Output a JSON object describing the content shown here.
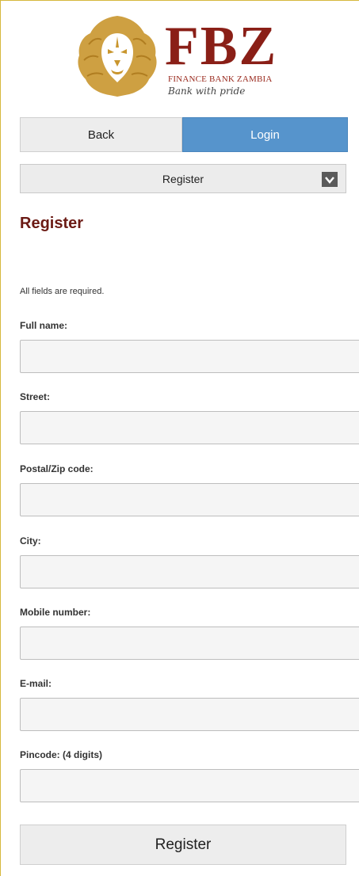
{
  "brand": {
    "name": "FBZ",
    "full_name": "FINANCE BANK ZAMBIA",
    "tagline": "Bank with pride",
    "logo_icon": "lion-head-icon",
    "colors": {
      "brand_red": "#8a1f17",
      "lion_gold": "#c9962e",
      "accent_blue": "#5694cc"
    }
  },
  "nav": {
    "back_label": "Back",
    "login_label": "Login"
  },
  "menu_select": {
    "selected": "Register",
    "icon": "chevron-down-icon"
  },
  "form": {
    "title": "Register",
    "note": "All fields are required.",
    "fields": [
      {
        "label": "Full name:",
        "value": ""
      },
      {
        "label": "Street:",
        "value": ""
      },
      {
        "label": "Postal/Zip code:",
        "value": ""
      },
      {
        "label": "City:",
        "value": ""
      },
      {
        "label": "Mobile number:",
        "value": ""
      },
      {
        "label": "E-mail:",
        "value": ""
      },
      {
        "label": "Pincode: (4 digits)",
        "value": ""
      }
    ],
    "submit_label": "Register"
  }
}
